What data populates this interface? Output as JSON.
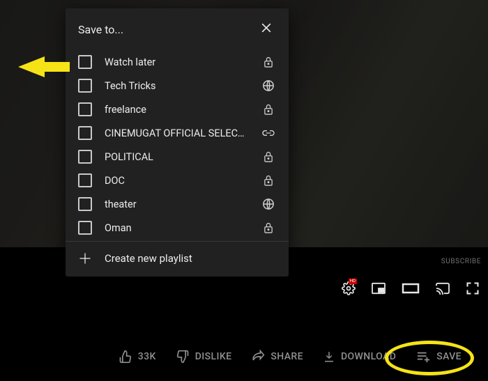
{
  "modal": {
    "title": "Save to...",
    "create_label": "Create new playlist",
    "playlists": [
      {
        "label": "Watch later",
        "privacy": "private"
      },
      {
        "label": "Tech Tricks",
        "privacy": "public"
      },
      {
        "label": "freelance",
        "privacy": "private"
      },
      {
        "label": "CINEMUGAT OFFICIAL SELECTION",
        "privacy": "unlisted"
      },
      {
        "label": "POLITICAL",
        "privacy": "private"
      },
      {
        "label": "DOC",
        "privacy": "private"
      },
      {
        "label": "theater",
        "privacy": "public"
      },
      {
        "label": "Oman",
        "privacy": "private"
      }
    ]
  },
  "subscribe_label": "SUBSCRIBE",
  "settings_badge": "HD",
  "actions": {
    "like_count": "33K",
    "dislike_label": "DISLIKE",
    "share_label": "SHARE",
    "download_label": "DOWNLOAD",
    "save_label": "SAVE"
  },
  "colors": {
    "highlight": "#f6e316",
    "modal_bg": "#212121"
  }
}
